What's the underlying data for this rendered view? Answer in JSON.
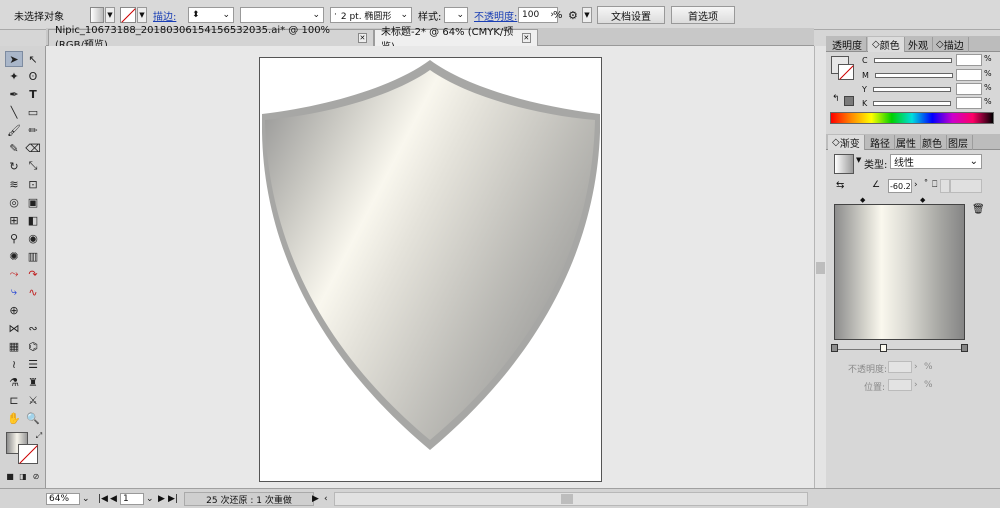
{
  "control_bar": {
    "selection": "未选择对象",
    "stroke_link": "描边:",
    "stroke_weight": "",
    "brush": "2 pt. 椭圆形",
    "style_label": "样式:",
    "opacity_link": "不透明度:",
    "opacity_value": "100",
    "opacity_unit": "%",
    "doc_setup": "文档设置",
    "preferences": "首选项"
  },
  "tabs": [
    {
      "label": "Nipic_10673188_20180306154156532035.ai* @ 100% (RGB/预览)",
      "active": false
    },
    {
      "label": "未标题-2* @ 64% (CMYK/预览)",
      "active": true
    }
  ],
  "status_bar": {
    "zoom": "64%",
    "page": "1",
    "message": "25 次还原 : 1 次重做"
  },
  "color_panel": {
    "tabs": [
      "透明度",
      "颜色",
      "外观",
      "描边"
    ],
    "active_tab": "颜色",
    "channels": [
      {
        "label": "C",
        "value": ""
      },
      {
        "label": "M",
        "value": ""
      },
      {
        "label": "Y",
        "value": ""
      },
      {
        "label": "K",
        "value": ""
      }
    ],
    "channel_unit": "%"
  },
  "gradient_panel": {
    "tabs": [
      "渐变",
      "路径",
      "属性",
      "颜色",
      "图层"
    ],
    "active_tab": "渐变",
    "type_label": "类型:",
    "type_value": "线性",
    "angle": "-60.2",
    "angle_unit": "°",
    "opacity_label": "不透明度:",
    "location_label": "位置:",
    "percent": "%"
  },
  "colors": {
    "accent_blue": "#1a3fb5",
    "panel_bg": "#d7d7d7",
    "shield_border": "#a7a7a5"
  }
}
